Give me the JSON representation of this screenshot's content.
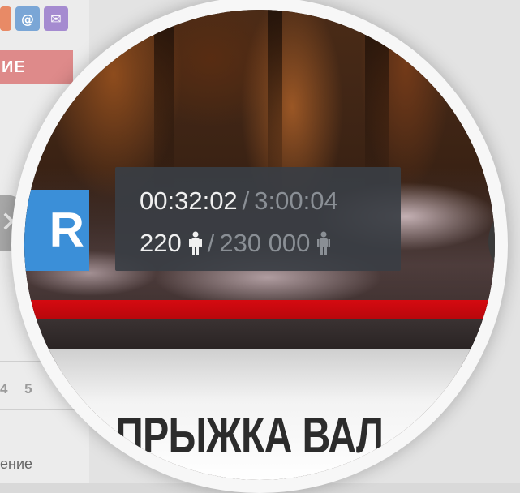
{
  "background": {
    "sidebar_icons": [
      {
        "name": "social-icon",
        "glyph": ""
      },
      {
        "name": "at-icon",
        "glyph": "@"
      },
      {
        "name": "mail-icon",
        "glyph": "✉"
      }
    ],
    "red_button_label": "ИЕ",
    "close_glyph": "✕",
    "pager": "4 5",
    "bottom_text": "ение"
  },
  "player": {
    "logo_letter": "R",
    "time": {
      "current": "00:32:02",
      "separator": "/",
      "total": "3:00:04"
    },
    "viewers": {
      "current": "220",
      "separator": "/",
      "total": "230 000"
    },
    "accent_red": "#d50a10",
    "panel_color": "#3a3e44"
  },
  "headline": "ПРЫЖКА ВАЛ"
}
